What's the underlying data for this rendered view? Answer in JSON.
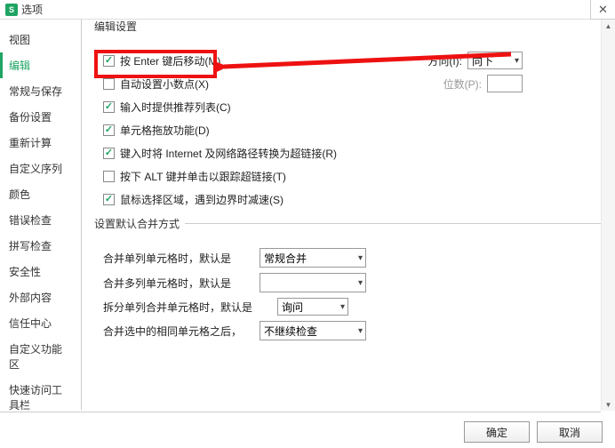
{
  "window": {
    "title": "选项"
  },
  "sidebar": {
    "items": [
      {
        "label": "视图"
      },
      {
        "label": "编辑"
      },
      {
        "label": "常规与保存"
      },
      {
        "label": "备份设置"
      },
      {
        "label": "重新计算"
      },
      {
        "label": "自定义序列"
      },
      {
        "label": "颜色"
      },
      {
        "label": "错误检查"
      },
      {
        "label": "拼写检查"
      },
      {
        "label": "安全性"
      },
      {
        "label": "外部内容"
      },
      {
        "label": "信任中心"
      },
      {
        "label": "自定义功能区"
      },
      {
        "label": "快速访问工具栏"
      }
    ],
    "active_index": 1
  },
  "sections": {
    "edit": "编辑设置",
    "merge": "设置默认合并方式"
  },
  "options": {
    "press_enter_move": "按 Enter 键后移动(M)",
    "direction_label": "方向(I):",
    "direction_value": "向下",
    "auto_decimal": "自动设置小数点(X)",
    "decimal_places_label": "位数(P):",
    "autocomplete": "输入时提供推荐列表(C)",
    "drag_drop": "单元格拖放功能(D)",
    "internet_link": "键入时将 Internet 及网络路径转换为超链接(R)",
    "alt_click": "按下 ALT 键并单击以跟踪超链接(T)",
    "mouse_select": "鼠标选择区域，遇到边界时减速(S)"
  },
  "merge": {
    "single_col": "合并单列单元格时，默认是",
    "single_col_value": "常规合并",
    "multi_col": "合并多列单元格时，默认是",
    "multi_col_value": "",
    "split": "拆分单列合并单元格时，默认是",
    "split_value": "询问",
    "same_after": "合并选中的相同单元格之后，",
    "same_after_value": "不继续检查"
  },
  "buttons": {
    "ok": "确定",
    "cancel": "取消"
  }
}
